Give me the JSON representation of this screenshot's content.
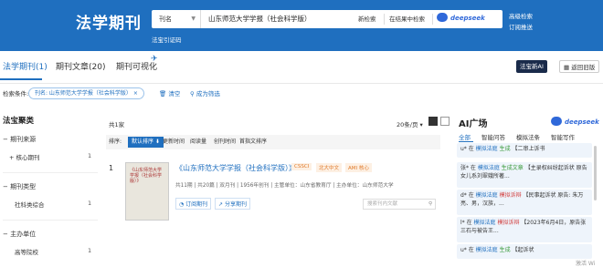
{
  "header": {
    "logo": "法学期刊",
    "search_field": "刊名",
    "search_value": "山东师范大学学报（社会科学版）",
    "new_search": "新检索",
    "search_in_results": "在结果中检索",
    "deepseek": "deepseek",
    "advanced_search": "高级检索",
    "subscribe": "订阅推送",
    "sub_link": "法宝引证码",
    "color_brand": "#1f6fbf"
  },
  "tabs": [
    {
      "label": "法学期刊(1)"
    },
    {
      "label": "期刊文章(20)"
    },
    {
      "label": "期刊可视化"
    }
  ],
  "tabs_right": {
    "fabao_ai": "法宝新AI",
    "back": "返回旧版"
  },
  "filter": {
    "label": "检索条件:",
    "chip": "刊名: 山东师范大学学报（社会科学版）",
    "clear": "清空",
    "save": "成为筛选"
  },
  "sidebar": {
    "title": "法宝聚类",
    "groups": [
      {
        "label": "期刊来源",
        "items": [
          {
            "label": "核心期刊",
            "count": "1"
          }
        ]
      },
      {
        "label": "期刊类型",
        "items": [
          {
            "label": "社科类综合",
            "count": "1"
          }
        ]
      },
      {
        "label": "主办单位",
        "items": [
          {
            "label": "高等院校",
            "count": "1"
          }
        ]
      }
    ]
  },
  "main": {
    "total": "共1家",
    "per_page": "20条/页",
    "sort_label": "排序:",
    "sort_options": [
      "默认排序",
      "更新时间",
      "阅读量",
      "创刊时间",
      "首指文排序"
    ],
    "result": {
      "index": "1",
      "title": "《山东师范大学学报（社会科学版）》",
      "tags": [
        "CSSCI",
        "北大中文",
        "AMI 核心"
      ],
      "meta": "共11期 | 共20篇 | 双月刊 | 1956年创刊 | 主管单位：山东省教育厅 | 主办单位：山东师范大学",
      "subscribe": "订阅期刊",
      "share": "分享期刊",
      "search_placeholder": "搜索刊内文献"
    }
  },
  "ai": {
    "title": "AI广场",
    "deepseek": "deepseek",
    "tabs": [
      "全部",
      "智能问答",
      "模拟法条",
      "智能写作"
    ],
    "cards": [
      {
        "pre": "u* 在",
        "tool": "模拟法庭",
        "act": "生成",
        "text": "【二审上诉书"
      },
      {
        "pre": "张* 在",
        "tool": "模拟法庭",
        "act": "生成文章",
        "text": "【主录权纠纷起诉状 原告女儿系刘翠娥所著..."
      },
      {
        "pre": "d* 在",
        "tool": "模拟法庭",
        "act": "模拟诉辩",
        "text": "【民事起诉状 原告: 朱万亮、男，汉族，..."
      },
      {
        "pre": "l* 在",
        "tool": "模拟法庭",
        "act": "模拟诉辩",
        "text": "【2023年6月4日，原告张三石与被告王..."
      },
      {
        "pre": "u* 在",
        "tool": "模拟法庭",
        "act": "生成",
        "text": "【起诉状"
      }
    ]
  },
  "watermark": "激活 Wi"
}
